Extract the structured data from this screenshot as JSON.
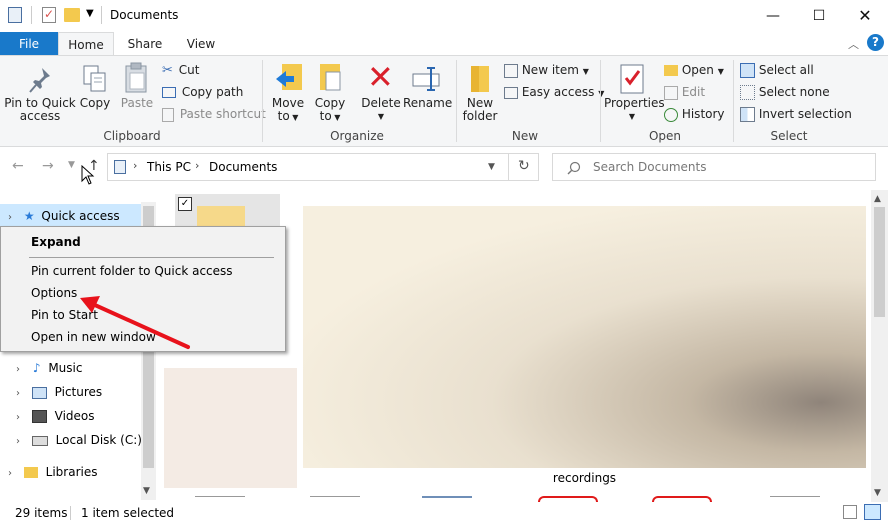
{
  "window": {
    "title": "Documents"
  },
  "ribbon_tabs": {
    "file": "File",
    "home": "Home",
    "share": "Share",
    "view": "View"
  },
  "ribbon": {
    "clipboard": {
      "pin_line1": "Pin to Quick",
      "pin_line2": "access",
      "copy": "Copy",
      "paste": "Paste",
      "cut": "Cut",
      "copy_path": "Copy path",
      "paste_shortcut": "Paste shortcut",
      "label": "Clipboard"
    },
    "organize": {
      "move_line1": "Move",
      "move_line2": "to",
      "copy_line1": "Copy",
      "copy_line2": "to",
      "delete": "Delete",
      "rename": "Rename",
      "label": "Organize"
    },
    "new": {
      "folder_line1": "New",
      "folder_line2": "folder",
      "new_item": "New item",
      "easy_access": "Easy access",
      "label": "New"
    },
    "open": {
      "properties": "Properties",
      "open": "Open",
      "edit": "Edit",
      "history": "History",
      "label": "Open"
    },
    "select": {
      "select_all": "Select all",
      "select_none": "Select none",
      "invert": "Invert selection",
      "label": "Select"
    }
  },
  "address": {
    "root": "This PC",
    "folder": "Documents"
  },
  "search": {
    "placeholder": "Search Documents"
  },
  "nav_pane": {
    "items": [
      "Quick access",
      "Music",
      "Pictures",
      "Videos",
      "Local Disk (C:)",
      "Libraries"
    ]
  },
  "context_menu": {
    "items": [
      "Expand",
      "Pin current folder to Quick access",
      "Options",
      "Pin to Start",
      "Open in new window"
    ]
  },
  "content": {
    "recordings_label": "recordings"
  },
  "status": {
    "items": "29 items",
    "selected": "1 item selected"
  },
  "colors": {
    "accent": "#1979ca",
    "arrow": "#e8121b",
    "ribbon_bg": "#f5f6f7"
  }
}
